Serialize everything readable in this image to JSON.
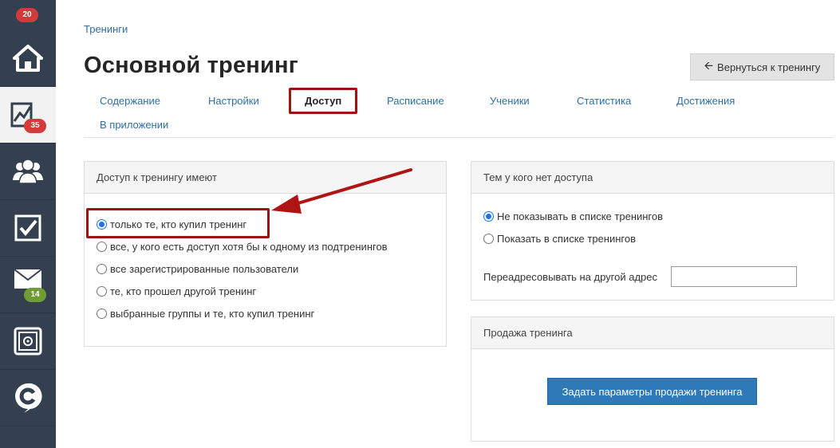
{
  "sidebar": {
    "top_badge": "20",
    "items": [
      {
        "icon": "home-icon",
        "badge": ""
      },
      {
        "icon": "training-chart-icon",
        "badge": "35",
        "active": true
      },
      {
        "icon": "users-icon",
        "badge": ""
      },
      {
        "icon": "tasks-checkbox-icon",
        "badge": ""
      },
      {
        "icon": "mail-icon",
        "badge": "14"
      },
      {
        "icon": "safe-icon",
        "badge": ""
      },
      {
        "icon": "getcourse-logo-icon",
        "badge": ""
      }
    ]
  },
  "breadcrumb": "Тренинги",
  "page_title": "Основной тренинг",
  "back_button": "Вернуться к тренингу",
  "tabs": [
    "Содержание",
    "Настройки",
    "Доступ",
    "Расписание",
    "Ученики",
    "Статистика",
    "Достижения",
    "В приложении"
  ],
  "active_tab": "Доступ",
  "access_panel": {
    "title": "Доступ к тренингу имеют",
    "options": [
      "только те, кто купил тренинг",
      "все, у кого есть доступ хотя бы к одному из подтренингов",
      "все зарегистрированные пользователи",
      "те, кто прошел другой тренинг",
      "выбранные группы и те, кто купил тренинг"
    ],
    "selected": 0
  },
  "no_access_panel": {
    "title": "Тем у кого нет доступа",
    "options": [
      "Не показывать в списке тренингов",
      "Показать в списке тренингов"
    ],
    "selected": 0,
    "redirect_label": "Переадресовывать на другой адрес",
    "redirect_value": ""
  },
  "sale_panel": {
    "title": "Продажа тренинга",
    "button": "Задать параметры продажи тренинга"
  },
  "colors": {
    "sidebar_bg": "#34404f",
    "link": "#2f6f9f",
    "highlight": "#9b1414",
    "primary_button": "#2f79b9",
    "badge_red": "#d33a3a",
    "badge_green": "#6f9d31"
  }
}
